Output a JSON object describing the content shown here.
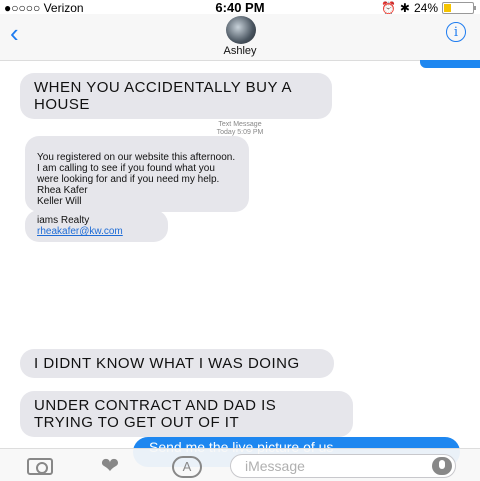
{
  "status_bar": {
    "carrier": "●○○○○ Verizon",
    "time": "6:40 PM",
    "battery_text": "24%",
    "battery_level": 0.24
  },
  "header": {
    "contact_name": "Ashley",
    "back_icon": "chevron-left-icon",
    "info_icon": "info-icon"
  },
  "messages": [
    {
      "text": "WHEN YOU ACCIDENTALLY BUY A HOUSE",
      "direction": "received"
    },
    {
      "meta_line1": "Text Message",
      "meta_line2": "Today 5:09 PM"
    },
    {
      "text": "You registered on our website this afternoon. I am calling to see if you found what you were looking for and if you need my help.\nRhea Kafer\nKeller Will",
      "direction": "received"
    },
    {
      "text": "iams Realty",
      "link": "rheakafer@kw.com",
      "direction": "received"
    },
    {
      "text": "I DIDNT KNOW WHAT I WAS DOING",
      "direction": "received"
    },
    {
      "text": "UNDER CONTRACT AND DAD IS TRYING TO GET OUT OF IT",
      "direction": "received"
    },
    {
      "text": "Send me the live picture of us",
      "direction": "sent"
    }
  ],
  "composer": {
    "placeholder": "iMessage",
    "camera_icon": "camera-icon",
    "digital_touch_icon": "heart-digital-touch-icon",
    "appstore_icon": "app-store-icon",
    "mic_icon": "microphone-icon"
  },
  "colors": {
    "accent": "#1e87f0",
    "received_bubble": "#e6e6eb"
  }
}
